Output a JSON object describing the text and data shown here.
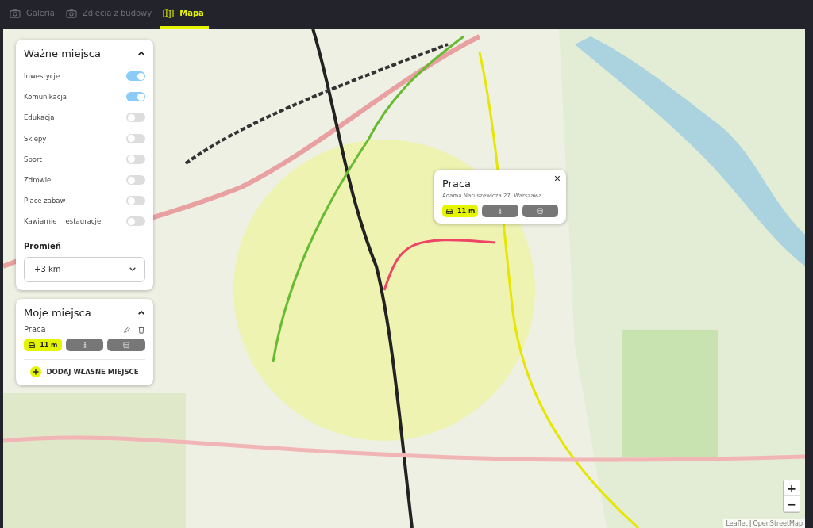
{
  "tabs": [
    {
      "label": "Galeria",
      "kind": "camera",
      "selected": false
    },
    {
      "label": "Zdjęcia z budowy",
      "kind": "camera",
      "selected": false
    },
    {
      "label": "Mapa",
      "kind": "map",
      "selected": true
    }
  ],
  "places_panel": {
    "title": "Ważne miejsca",
    "expanded": true,
    "layers": [
      {
        "label": "Inwestycje",
        "on": true
      },
      {
        "label": "Komunikacja",
        "on": true
      },
      {
        "label": "Edukacja",
        "on": false
      },
      {
        "label": "Sklepy",
        "on": false
      },
      {
        "label": "Sport",
        "on": false
      },
      {
        "label": "Zdrowie",
        "on": false
      },
      {
        "label": "Place zabaw",
        "on": false
      },
      {
        "label": "Kawiarnie i restauracje",
        "on": false
      }
    ],
    "radius_label": "Promień",
    "radius_value": "+3 km"
  },
  "my_places_panel": {
    "title": "Moje miejsca",
    "expanded": true,
    "places": [
      {
        "name": "Praca",
        "modes": [
          {
            "kind": "car",
            "selected": true,
            "time": "11 m"
          },
          {
            "kind": "walk",
            "selected": false
          },
          {
            "kind": "bus",
            "selected": false
          }
        ]
      }
    ],
    "add_button": "DODAJ WŁASNE MIEJSCE"
  },
  "popup": {
    "title": "Praca",
    "address": "Adama Naruszewicza 27, Warszawa",
    "modes": [
      {
        "kind": "car",
        "selected": true,
        "time": "11 m"
      },
      {
        "kind": "walk",
        "selected": false
      },
      {
        "kind": "bus",
        "selected": false
      }
    ]
  },
  "zoom": {
    "in": "+",
    "out": "−"
  },
  "attribution": {
    "leaflet": "Leaflet",
    "separator": "|",
    "osm": "OpenStreetMap"
  }
}
